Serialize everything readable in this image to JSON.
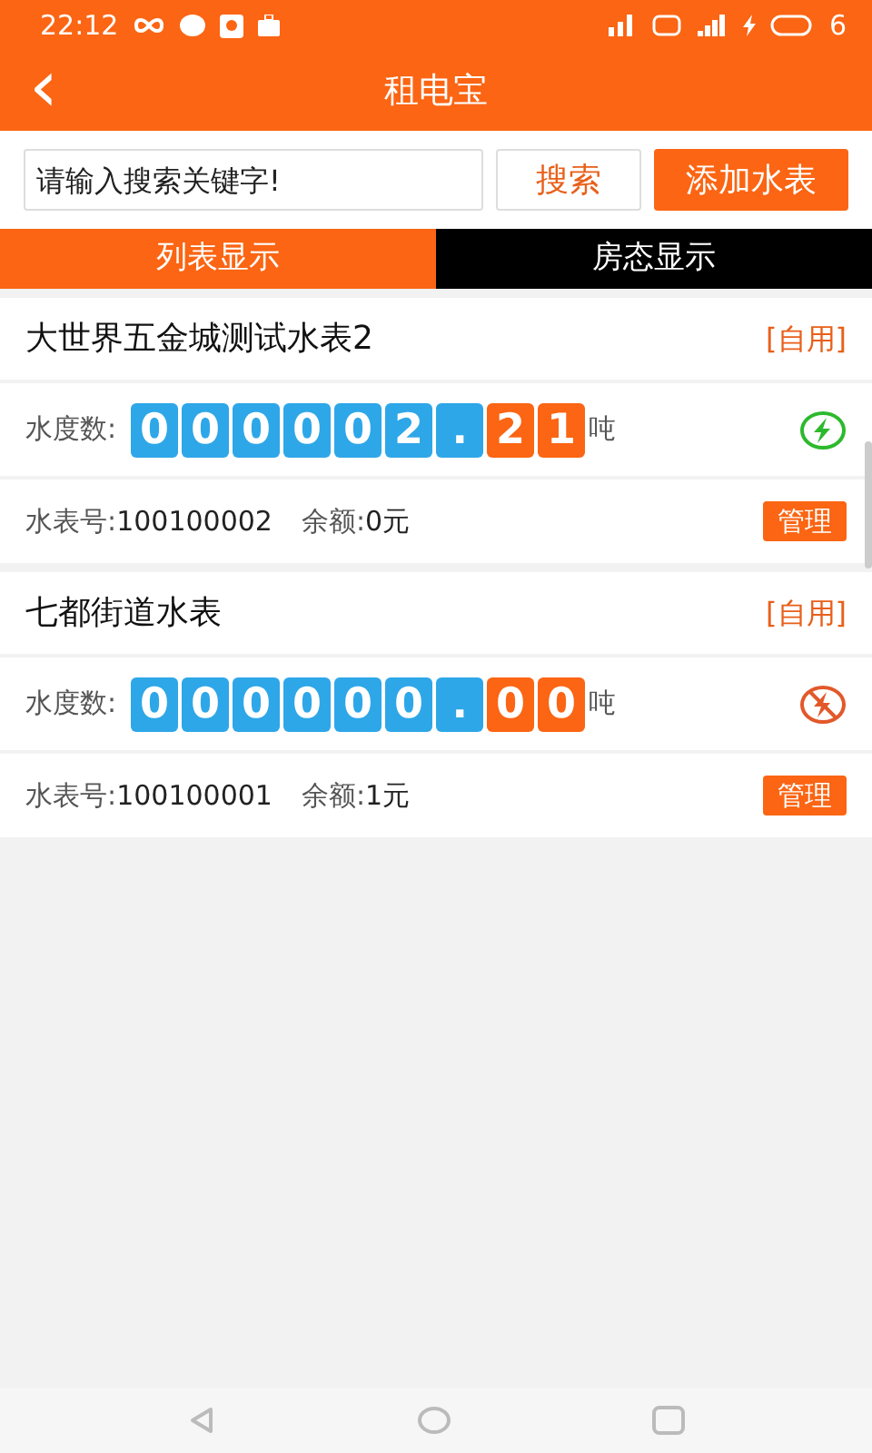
{
  "status_bar": {
    "time": "22:12",
    "battery": "6"
  },
  "header": {
    "back_icon": "‹",
    "title": "租电宝"
  },
  "search": {
    "placeholder": "请输入搜索关键字!",
    "search_button": "搜索",
    "add_button": "添加水表"
  },
  "tabs": [
    {
      "label": "列表显示",
      "selected": true
    },
    {
      "label": "房态显示",
      "selected": false
    }
  ],
  "meters": [
    {
      "name": "大世界五金城测试水表2",
      "tag": "[自用]",
      "reading_label": "水度数:",
      "digits": [
        {
          "text": "0",
          "kind": "integer"
        },
        {
          "text": "0",
          "kind": "integer"
        },
        {
          "text": "0",
          "kind": "integer"
        },
        {
          "text": "0",
          "kind": "integer"
        },
        {
          "text": "0",
          "kind": "integer"
        },
        {
          "text": "2",
          "kind": "integer"
        },
        {
          "text": ".",
          "kind": "point"
        },
        {
          "text": "2",
          "kind": "decimal"
        },
        {
          "text": "1",
          "kind": "decimal"
        }
      ],
      "unit": "吨",
      "power_on": true,
      "number_label": "水表号:",
      "number": "100100002",
      "balance_label": "余额:",
      "balance": "0元",
      "manage_button": "管理"
    },
    {
      "name": "七都街道水表",
      "tag": "[自用]",
      "reading_label": "水度数:",
      "digits": [
        {
          "text": "0",
          "kind": "integer"
        },
        {
          "text": "0",
          "kind": "integer"
        },
        {
          "text": "0",
          "kind": "integer"
        },
        {
          "text": "0",
          "kind": "integer"
        },
        {
          "text": "0",
          "kind": "integer"
        },
        {
          "text": "0",
          "kind": "integer"
        },
        {
          "text": ".",
          "kind": "point"
        },
        {
          "text": "0",
          "kind": "decimal"
        },
        {
          "text": "0",
          "kind": "decimal"
        }
      ],
      "unit": "吨",
      "power_on": false,
      "number_label": "水表号:",
      "number": "100100001",
      "balance_label": "余额:",
      "balance": "1元",
      "manage_button": "管理"
    }
  ]
}
